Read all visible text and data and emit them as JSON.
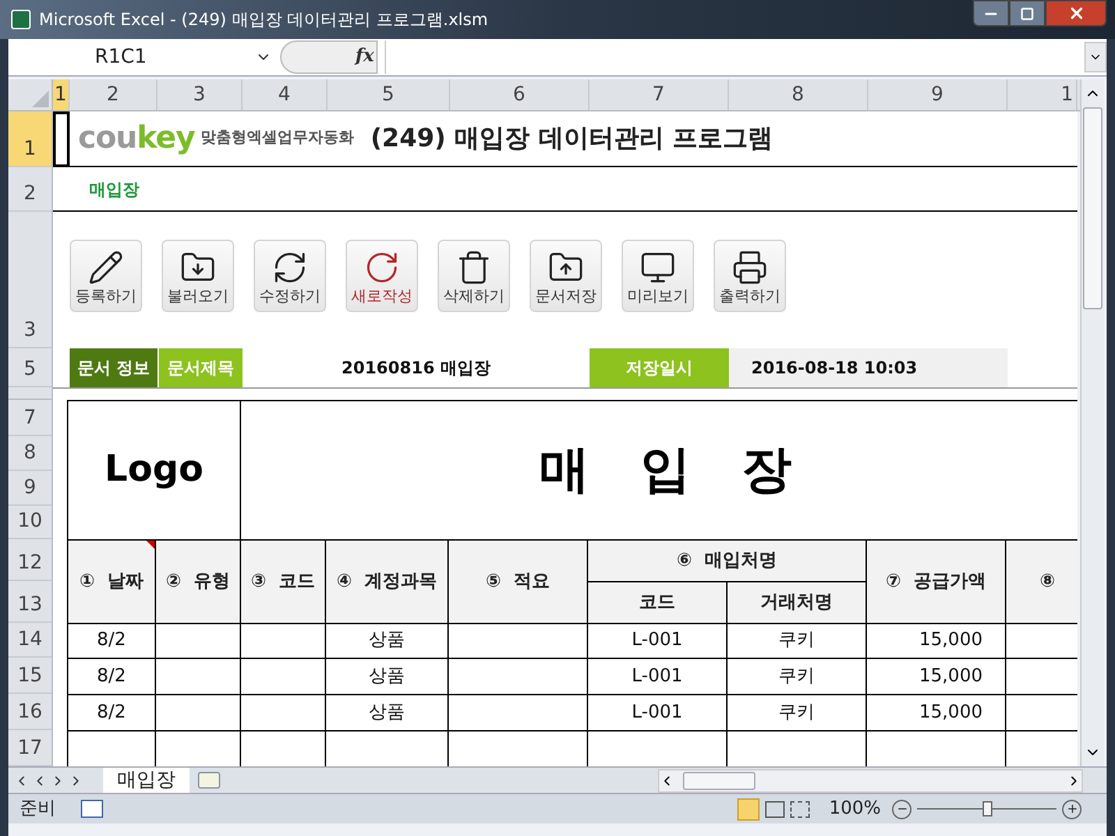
{
  "window": {
    "title": "Microsoft Excel - (249) 매입장 데이터관리 프로그램.xlsm"
  },
  "formula_bar": {
    "name_box": "R1C1",
    "function_label": "fx"
  },
  "column_headers": [
    {
      "label": "1",
      "selected": true
    },
    {
      "label": "2",
      "selected": false
    },
    {
      "label": "3",
      "selected": false
    },
    {
      "label": "4",
      "selected": false
    },
    {
      "label": "5",
      "selected": false
    },
    {
      "label": "6",
      "selected": false
    },
    {
      "label": "7",
      "selected": false
    },
    {
      "label": "8",
      "selected": false
    },
    {
      "label": "9",
      "selected": false
    },
    {
      "label": "1",
      "selected": false
    }
  ],
  "row_headers": [
    {
      "label": "1",
      "selected": true
    },
    {
      "label": "2",
      "selected": false
    },
    {
      "label": "3",
      "selected": false
    },
    {
      "label": "5",
      "selected": false
    },
    {
      "label": "7",
      "selected": false
    },
    {
      "label": "8",
      "selected": false
    },
    {
      "label": "9",
      "selected": false
    },
    {
      "label": "10",
      "selected": false
    },
    {
      "label": "12",
      "selected": false
    },
    {
      "label": "13",
      "selected": false
    },
    {
      "label": "14",
      "selected": false
    },
    {
      "label": "15",
      "selected": false
    },
    {
      "label": "16",
      "selected": false
    },
    {
      "label": "17",
      "selected": false
    }
  ],
  "sheet": {
    "brand": {
      "gray_part": "cou",
      "green_part": "key",
      "tagline": "맞춤형엑셀업무자동화"
    },
    "title": "(249) 매입장 데이터관리 프로그램",
    "subtitle": "매입장",
    "buttons": [
      {
        "label": "등록하기",
        "kind": "pencil",
        "emphasized": false
      },
      {
        "label": "불러오기",
        "kind": "folder-down",
        "emphasized": false
      },
      {
        "label": "수정하기",
        "kind": "refresh",
        "emphasized": false
      },
      {
        "label": "새로작성",
        "kind": "rotate",
        "emphasized": true
      },
      {
        "label": "삭제하기",
        "kind": "trash",
        "emphasized": false
      },
      {
        "label": "문서저장",
        "kind": "folder-up",
        "emphasized": false
      },
      {
        "label": "미리보기",
        "kind": "monitor",
        "emphasized": false
      },
      {
        "label": "출력하기",
        "kind": "printer",
        "emphasized": false
      }
    ],
    "info": {
      "doc_info_label": "문서 정보",
      "title_label": "문서제목",
      "title_value": "20160816 매입장",
      "saved_label": "저장일시",
      "saved_value": "2016-08-18 10:03"
    },
    "form": {
      "logo": "Logo",
      "heading": "매 입 장",
      "columns": [
        "①  날짜",
        "②  유형",
        "③  코드",
        "④  계정과목",
        "⑤  적요",
        "⑦  공급가액",
        "⑧"
      ],
      "group_header": "⑥  매입처명",
      "sub_columns": [
        "코드",
        "거래처명"
      ],
      "rows": [
        {
          "date": "8/2",
          "account": "상품",
          "vendor_code": "L-001",
          "vendor_name": "쿠키",
          "amount": "15,000"
        },
        {
          "date": "8/2",
          "account": "상품",
          "vendor_code": "L-001",
          "vendor_name": "쿠키",
          "amount": "15,000"
        },
        {
          "date": "8/2",
          "account": "상품",
          "vendor_code": "L-001",
          "vendor_name": "쿠키",
          "amount": "15,000"
        }
      ]
    }
  },
  "sheet_tabs": [
    {
      "label": "매입장",
      "selected": true
    }
  ],
  "status_bar": {
    "status": "준비",
    "zoom": "100%",
    "level": 0.5
  }
}
